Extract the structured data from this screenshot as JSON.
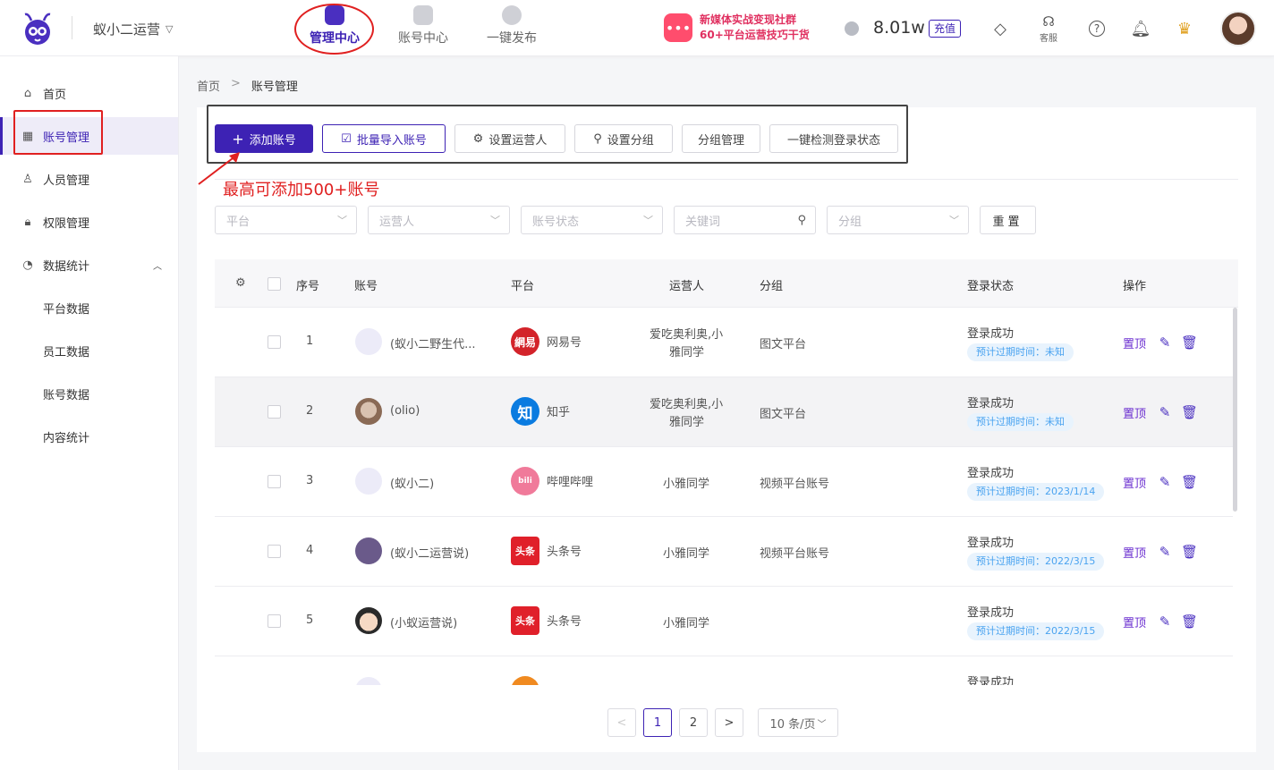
{
  "header": {
    "brand": "蚁小二运营",
    "nav": [
      {
        "label": "管理中心",
        "active": true
      },
      {
        "label": "账号中心",
        "active": false
      },
      {
        "label": "一键发布",
        "active": false
      }
    ],
    "promo_line1": "新媒体实战变现社群",
    "promo_line2": "60+平台运营技巧干货",
    "balance": "8.01w",
    "recharge": "充值",
    "service_label": "客服",
    "icons": [
      "diamond-icon",
      "headset-icon",
      "help-icon",
      "bell-icon",
      "crown-icon"
    ]
  },
  "sidebar": {
    "items": [
      {
        "label": "首页",
        "icon": "home-icon"
      },
      {
        "label": "账号管理",
        "icon": "grid-icon",
        "active": true
      },
      {
        "label": "人员管理",
        "icon": "user-icon"
      },
      {
        "label": "权限管理",
        "icon": "lock-icon"
      },
      {
        "label": "数据统计",
        "icon": "chart-icon",
        "expanded": true
      }
    ],
    "subitems": [
      "平台数据",
      "员工数据",
      "账号数据",
      "内容统计"
    ]
  },
  "breadcrumb": {
    "home": "首页",
    "sep": ">",
    "current": "账号管理"
  },
  "toolbar": {
    "add": "添加账号",
    "batch_import": "批量导入账号",
    "set_operator": "设置运营人",
    "set_group": "设置分组",
    "group_manage": "分组管理",
    "check_login": "一键检测登录状态"
  },
  "annotation": "最高可添加500+账号",
  "filters": {
    "platform": "平台",
    "operator": "运营人",
    "status": "账号状态",
    "keyword": "关键词",
    "group": "分组",
    "reset": "重置"
  },
  "table": {
    "headers": {
      "index": "序号",
      "account": "账号",
      "platform": "平台",
      "operator": "运营人",
      "group": "分组",
      "login_status": "登录状态",
      "action": "操作"
    },
    "rows": [
      {
        "index": "1",
        "account": "(蚁小二野生代...",
        "platform": "网易号",
        "operator_l1": "爱吃奥利奥,小",
        "operator_l2": "雅同学",
        "group": "图文平台",
        "login": "登录成功",
        "expire": "预计过期时间：未知",
        "top": "置顶"
      },
      {
        "index": "2",
        "account": "(olio)",
        "platform": "知乎",
        "operator_l1": "爱吃奥利奥,小",
        "operator_l2": "雅同学",
        "group": "图文平台",
        "login": "登录成功",
        "expire": "预计过期时间：未知",
        "top": "置顶"
      },
      {
        "index": "3",
        "account": "(蚁小二)",
        "platform": "哔哩哔哩",
        "operator_l1": "小雅同学",
        "operator_l2": "",
        "group": "视频平台账号",
        "login": "登录成功",
        "expire": "预计过期时间：2023/1/14",
        "top": "置顶"
      },
      {
        "index": "4",
        "account": "(蚁小二运营说)",
        "platform": "头条号",
        "operator_l1": "小雅同学",
        "operator_l2": "",
        "group": "视频平台账号",
        "login": "登录成功",
        "expire": "预计过期时间：2022/3/15",
        "top": "置顶"
      },
      {
        "index": "5",
        "account": "(小蚁运营说)",
        "platform": "头条号",
        "operator_l1": "小雅同学",
        "operator_l2": "",
        "group": "",
        "login": "登录成功",
        "expire": "预计过期时间：2022/3/15",
        "top": "置顶"
      }
    ],
    "partial_row_login": "登录成功"
  },
  "pagination": {
    "prev": "<",
    "pages": [
      "1",
      "2"
    ],
    "next": ">",
    "size": "10 条/页"
  },
  "colors": {
    "accent": "#3d22b4",
    "annotation_red": "#e02020",
    "expire_blue": "#4aa3f0"
  }
}
